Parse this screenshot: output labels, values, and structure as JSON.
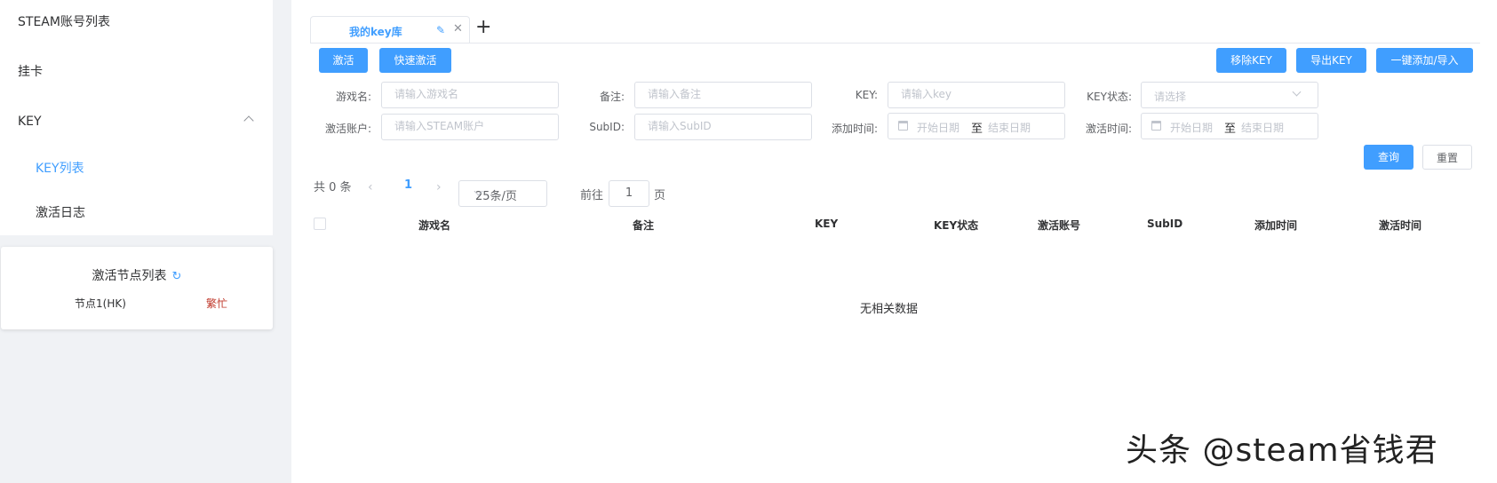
{
  "sidebar": {
    "items": [
      {
        "label": "STEAM账号列表"
      },
      {
        "label": "挂卡"
      },
      {
        "label": "KEY"
      },
      {
        "label": "KEY列表"
      },
      {
        "label": "激活日志"
      }
    ]
  },
  "nodes": {
    "title": "激活节点列表",
    "node_name": "节点1(HK)",
    "node_status": "繁忙"
  },
  "tab": {
    "label": "我的key库"
  },
  "actions": {
    "activate": "激活",
    "quick_activate": "快速激活",
    "remove_key": "移除KEY",
    "export_key": "导出KEY",
    "add_import": "一键添加/导入",
    "query": "查询",
    "reset": "重置"
  },
  "filters": {
    "game_label": "游戏名:",
    "game_placeholder": "请输入游戏名",
    "remark_label": "备注:",
    "remark_placeholder": "请输入备注",
    "key_label": "KEY:",
    "key_placeholder": "请输入key",
    "status_label": "KEY状态:",
    "status_placeholder": "请选择",
    "account_label": "激活账户:",
    "account_placeholder": "请输入STEAM账户",
    "subid_label": "SubID:",
    "subid_placeholder": "请输入SubID",
    "add_time_label": "添加时间:",
    "act_time_label": "激活时间:",
    "start_date": "开始日期",
    "to": "至",
    "end_date": "结束日期"
  },
  "pagination": {
    "total": "共 0 条",
    "current": "1",
    "page_size": "25条/页",
    "goto": "前往",
    "page_value": "1",
    "page_unit": "页"
  },
  "table": {
    "headers": [
      "游戏名",
      "备注",
      "KEY",
      "KEY状态",
      "激活账号",
      "SubID",
      "添加时间",
      "激活时间"
    ],
    "empty_text": "无相关数据"
  },
  "watermark": "头条 @steam省钱君"
}
